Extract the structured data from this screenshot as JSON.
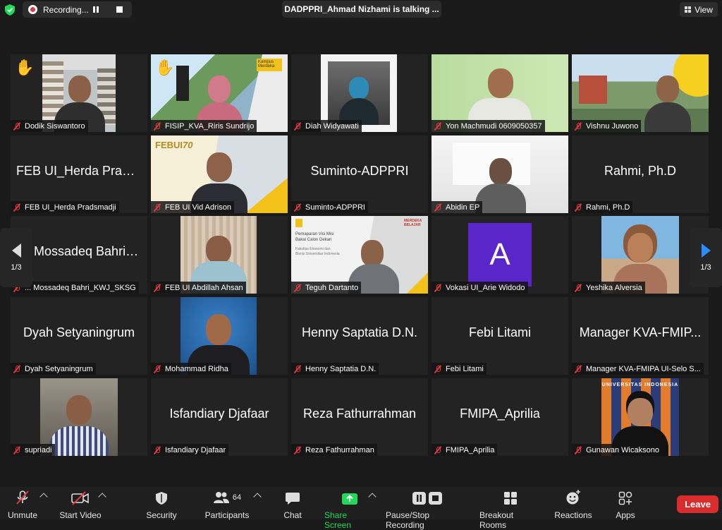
{
  "recording": {
    "label": "Recording..."
  },
  "speaker": {
    "text": "DADPPRI_Ahmad Nizhami is talking ..."
  },
  "view": {
    "label": "View"
  },
  "pagination": {
    "left": "1/3",
    "right": "1/3"
  },
  "participants": [
    {
      "name": "Dodik Siswantoro",
      "big": "",
      "video": true,
      "hand": true
    },
    {
      "name": "FISIP_KVA_Riris Sundrijo",
      "big": "",
      "video": true,
      "hand": true
    },
    {
      "name": "Diah Widyawati",
      "big": "",
      "video": true,
      "hand": false
    },
    {
      "name": "Yon Machmudi 0609050357",
      "big": "",
      "video": true,
      "hand": false
    },
    {
      "name": "Vishnu Juwono",
      "big": "",
      "video": true,
      "hand": false
    },
    {
      "name": "FEB UI_Herda Pradsmadji",
      "big": "FEB UI_Herda Prads...",
      "video": false,
      "hand": false
    },
    {
      "name": "FEB UI Vid Adrison",
      "big": "",
      "video": true,
      "hand": false
    },
    {
      "name": "Suminto-ADPPRI",
      "big": "Suminto-ADPPRI",
      "video": false,
      "hand": false
    },
    {
      "name": "Abidin EP",
      "big": "",
      "video": true,
      "hand": false
    },
    {
      "name": "Rahmi, Ph.D",
      "big": "Rahmi, Ph.D",
      "video": false,
      "hand": false
    },
    {
      "name": "... Mossadeq Bahri_KWJ_SKSG",
      "big": "M. Mossadeq Bahri_...",
      "video": false,
      "hand": false
    },
    {
      "name": "FEB UI Abdillah Ahsan",
      "big": "",
      "video": true,
      "hand": false
    },
    {
      "name": "Teguh Dartanto",
      "big": "",
      "video": true,
      "hand": false
    },
    {
      "name": "Vokasi UI_Arie Widodo",
      "big": "",
      "video": true,
      "hand": false,
      "avatar": "A"
    },
    {
      "name": "Yeshika Alversia",
      "big": "",
      "video": true,
      "hand": false
    },
    {
      "name": "Dyah Setyaningrum",
      "big": "Dyah Setyaningrum",
      "video": false,
      "hand": false
    },
    {
      "name": "Mohammad Ridha",
      "big": "",
      "video": true,
      "hand": false
    },
    {
      "name": "Henny Saptatia D.N.",
      "big": "Henny Saptatia D.N.",
      "video": false,
      "hand": false
    },
    {
      "name": "Febi Litami",
      "big": "Febi Litami",
      "video": false,
      "hand": false
    },
    {
      "name": "Manager KVA-FMIPA UI-Selo S...",
      "big": "Manager KVA-FMIP...",
      "video": false,
      "hand": false
    },
    {
      "name": "supriadi",
      "big": "",
      "video": true,
      "hand": false
    },
    {
      "name": "Isfandiary Djafaar",
      "big": "Isfandiary Djafaar",
      "video": false,
      "hand": false
    },
    {
      "name": "Reza Fathurrahman",
      "big": "Reza Fathurrahman",
      "video": false,
      "hand": false
    },
    {
      "name": "FMIPA_Aprilia",
      "big": "FMIPA_Aprilia",
      "video": false,
      "hand": false
    },
    {
      "name": "Gunawan Wicaksono",
      "big": "",
      "video": true,
      "hand": false
    }
  ],
  "tile_overlays": {
    "kampus": "Kampus Merdeka",
    "febui": "FEBUI",
    "febui_year": "70",
    "slide_title": "Pemaparan Visi Misi Bakal Calon Dekan",
    "slide_sub": "Fakultas Ekonomi dan Bisnis Universitas Indonesia",
    "merdeka": "MERDEKA BELAJAR",
    "ui_banner": "UNIVERSITAS INDONESIA"
  },
  "toolbar": {
    "unmute": "Unmute",
    "start_video": "Start Video",
    "security": "Security",
    "participants": "Participants",
    "participants_count": "64",
    "chat": "Chat",
    "share_screen": "Share Screen",
    "pause_stop": "Pause/Stop Recording",
    "breakout": "Breakout Rooms",
    "reactions": "Reactions",
    "apps": "Apps",
    "leave": "Leave"
  },
  "colors": {
    "accent_green": "#23d959",
    "leave_red": "#d92c2c",
    "arrow_blue": "#2d8cff",
    "avatar_purple": "#5b26c9"
  }
}
